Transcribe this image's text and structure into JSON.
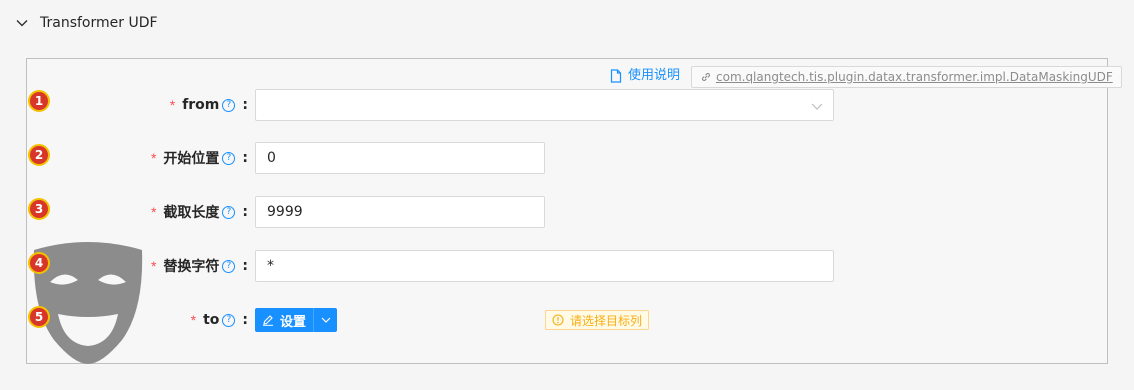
{
  "header": {
    "title": "Transformer UDF"
  },
  "doc": {
    "link_label": "使用说明",
    "class_name": "com.qlangtech.tis.plugin.datax.transformer.impl.DataMaskingUDF"
  },
  "badges": [
    "1",
    "2",
    "3",
    "4",
    "5"
  ],
  "fields": {
    "from": {
      "label": "from",
      "value": ""
    },
    "start": {
      "label": "开始位置",
      "value": "0"
    },
    "length": {
      "label": "截取长度",
      "value": "9999"
    },
    "replace": {
      "label": "替换字符",
      "value": "*"
    },
    "to": {
      "label": "to",
      "button_label": "设置"
    }
  },
  "required_mark": "*",
  "help_glyph": "?",
  "colon": ":",
  "warning": {
    "text": "请选择目标列"
  },
  "colors": {
    "accent": "#1890ff",
    "required": "#ff4d4f",
    "badge": "#d9362a",
    "warning": "#faad14"
  }
}
